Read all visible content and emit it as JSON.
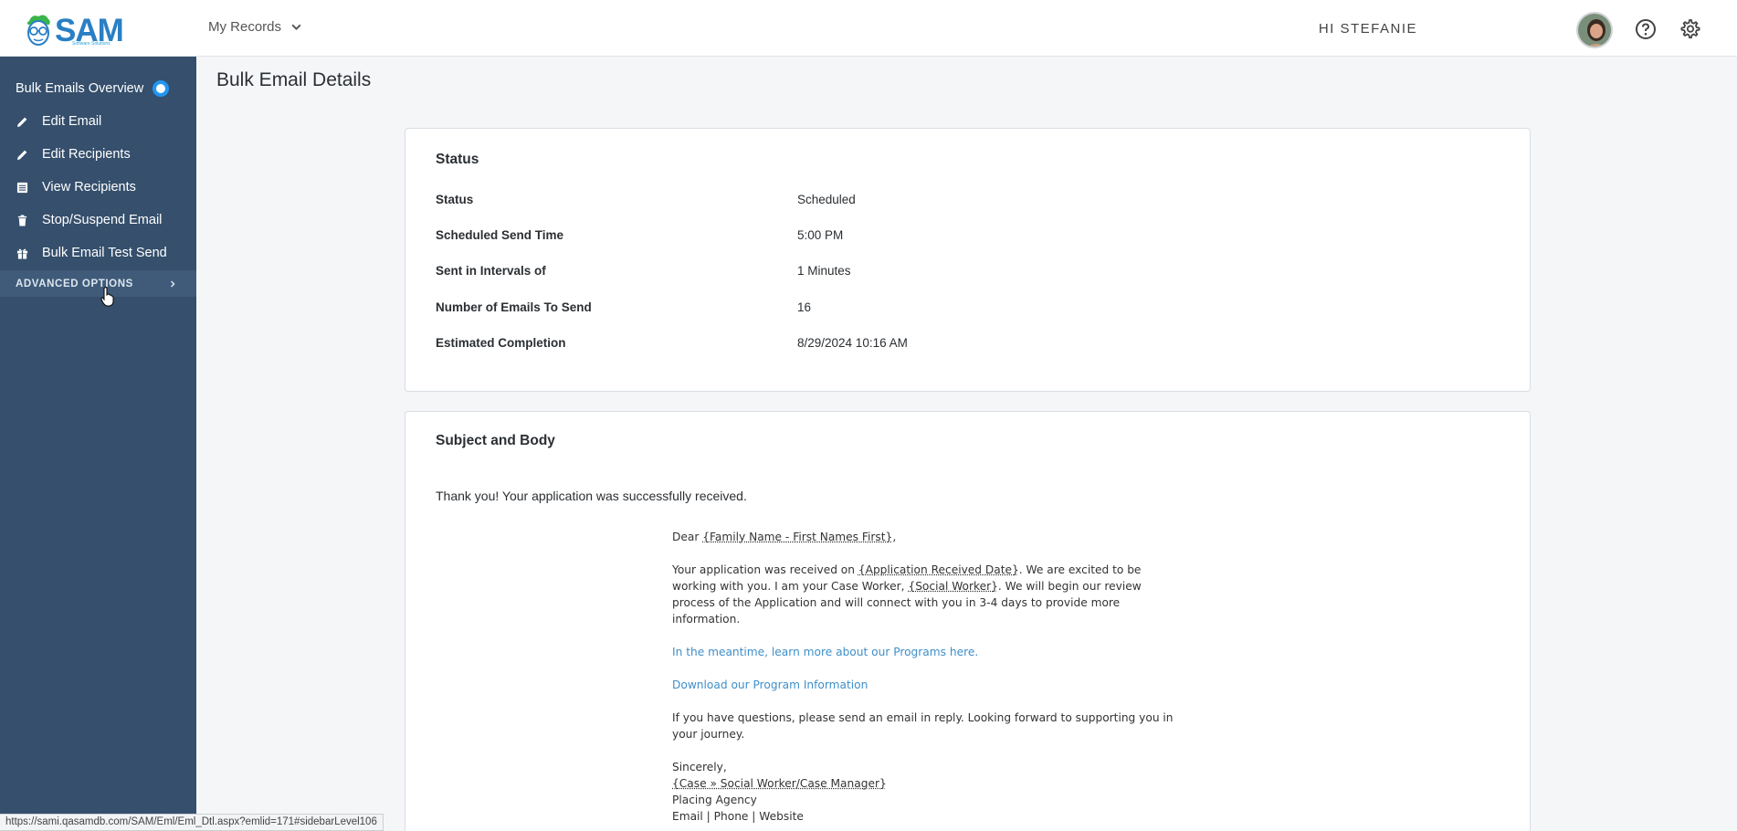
{
  "header": {
    "logo_text": "SAM",
    "logo_tagline": "Software Solutions",
    "records_menu": "My Records",
    "greeting": "HI STEFANIE"
  },
  "sidebar": {
    "items": [
      {
        "label": "Bulk Emails Overview",
        "icon": "loading-icon"
      },
      {
        "label": "Edit Email",
        "icon": "pencil-icon"
      },
      {
        "label": "Edit Recipients",
        "icon": "pencil-icon"
      },
      {
        "label": "View Recipients",
        "icon": "list-icon"
      },
      {
        "label": "Stop/Suspend Email",
        "icon": "trash-icon"
      },
      {
        "label": "Bulk Email Test Send",
        "icon": "gift-icon"
      }
    ],
    "advanced_label": "ADVANCED OPTIONS"
  },
  "main": {
    "title": "Bulk Email Details",
    "status_card": {
      "title": "Status",
      "rows": [
        {
          "label": "Status",
          "value": "Scheduled"
        },
        {
          "label": "Scheduled Send Time",
          "value": "5:00 PM"
        },
        {
          "label": "Sent in Intervals of",
          "value": "1 Minutes"
        },
        {
          "label": "Number of Emails To Send",
          "value": "16"
        },
        {
          "label": "Estimated Completion",
          "value": "8/29/2024 10:16 AM"
        }
      ]
    },
    "body_card": {
      "title": "Subject and Body",
      "subject": "Thank you! Your application was successfully received.",
      "email": {
        "dear": "Dear ",
        "dear_field": "{Family Name - First Names First}",
        "dear_end": ",",
        "p1_a": "Your application was received on ",
        "p1_field1": "{Application Received Date}",
        "p1_b": ".  We are excited to be working with you. I am your Case Worker, ",
        "p1_field2": "{Social Worker}",
        "p1_c": ". We will begin our review process of the Application and will connect with you in 3-4 days to provide more information.",
        "link1": "In the meantime, learn more about our Programs here.",
        "link2": "Download our Program Information",
        "p2": "If you have questions, please send an email in reply. Looking forward to supporting you in your journey.",
        "closing": "Sincerely,",
        "sig_field": "{Case » Social Worker/Case Manager}",
        "agency": "Placing Agency",
        "contact": "Email | Phone | Website"
      }
    }
  },
  "statusbar": {
    "url": "https://sami.qasamdb.com/SAM/Eml/Eml_Dtl.aspx?emlid=171#sidebarLevel106"
  },
  "colors": {
    "sidebar_bg": "#354f6c",
    "brand_blue": "#2a7fc4",
    "link": "#3f8fc9"
  }
}
